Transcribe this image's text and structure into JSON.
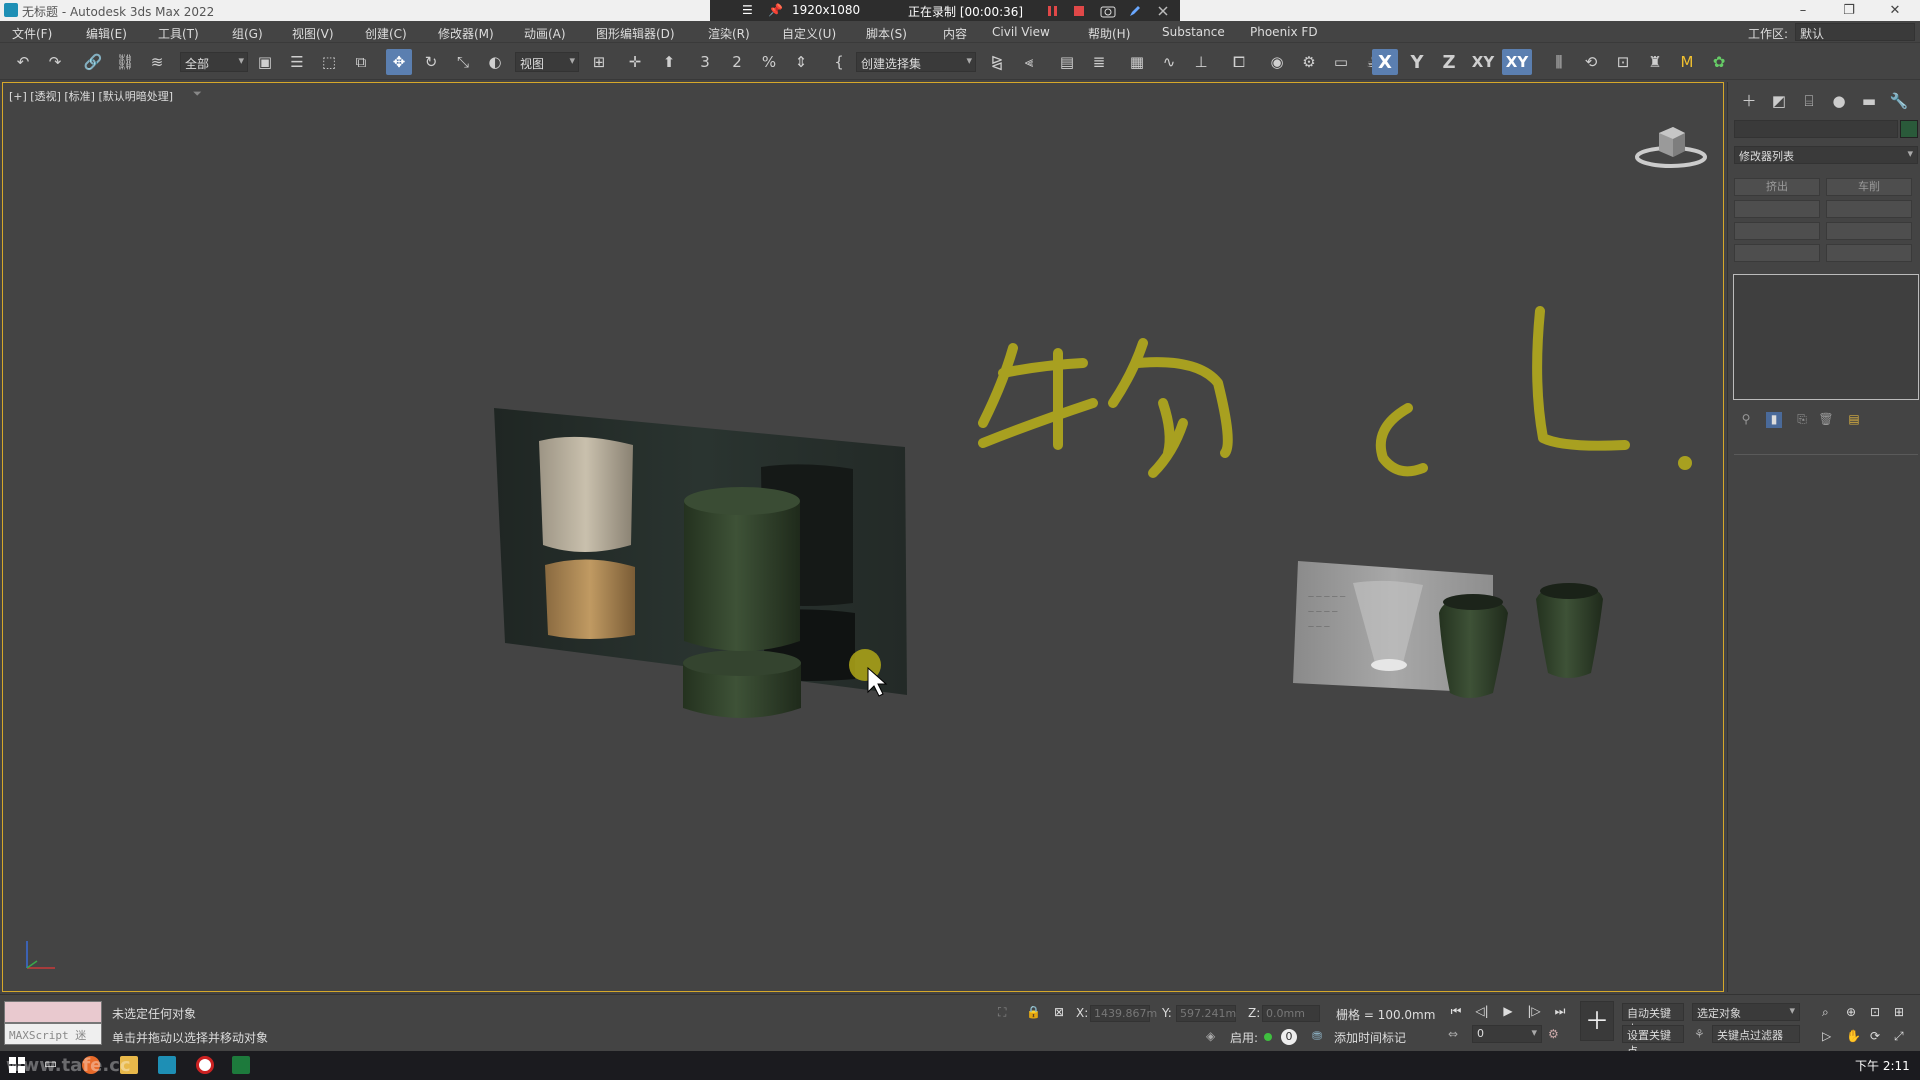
{
  "window": {
    "title": "无标题 - Autodesk 3ds Max 2022",
    "controls": {
      "minimize": "–",
      "restore": "❐",
      "close": "✕"
    }
  },
  "recorder": {
    "menu_glyph": "☰",
    "resolution": "1920x1080",
    "status": "正在录制 [00:00:36]"
  },
  "menu": {
    "items": [
      "文件(F)",
      "编辑(E)",
      "工具(T)",
      "组(G)",
      "视图(V)",
      "创建(C)",
      "修改器(M)",
      "动画(A)",
      "图形编辑器(D)",
      "渲染(R)",
      "自定义(U)",
      "脚本(S)",
      "内容",
      "Civil View",
      "帮助(H)",
      "Substance",
      "Phoenix FD"
    ],
    "workspace_label": "工作区:",
    "workspace_value": "默认"
  },
  "toolbar": {
    "selection_filter": "全部",
    "ref_coord": "视图",
    "named_selection": "创建选择集",
    "axis_x": "X",
    "axis_y": "Y",
    "axis_z": "Z",
    "axis_xy": "XY",
    "axis_xy2": "XY",
    "snap_3": "3",
    "snap_2": "2",
    "percent": "%",
    "mirror_M": "M"
  },
  "viewport": {
    "label": "[+] [透视] [标准] [默认明暗处理]",
    "annotation_chars": [
      "物",
      "c",
      "L"
    ],
    "annotation_color": "#a8a020",
    "plane_text_lines": [
      "— — — — —",
      "— — — —",
      "— — —"
    ]
  },
  "command_panel": {
    "modifier_list": "修改器列表",
    "buttons": [
      "挤出",
      "车削"
    ]
  },
  "status": {
    "maxscript_label": "MAXScript 迷",
    "line1": "未选定任何对象",
    "line2": "单击并拖动以选择并移动对象",
    "x_label": "X:",
    "x_value": "1439.867m",
    "y_label": "Y:",
    "y_value": "597.241m",
    "z_label": "Z:",
    "z_value": "0.0mm",
    "grid": "栅格 = 100.0mm",
    "enable_label": "启用:",
    "enable_value": "0",
    "add_time_tag": "添加时间标记",
    "auto_key": "自动关键点",
    "set_key": "设置关键点",
    "selected_object": "选定对象",
    "key_filter": "关键点过滤器",
    "frame": "0"
  },
  "taskbar": {
    "time": "下午 2:11",
    "watermark": "www.tafe.cc"
  }
}
